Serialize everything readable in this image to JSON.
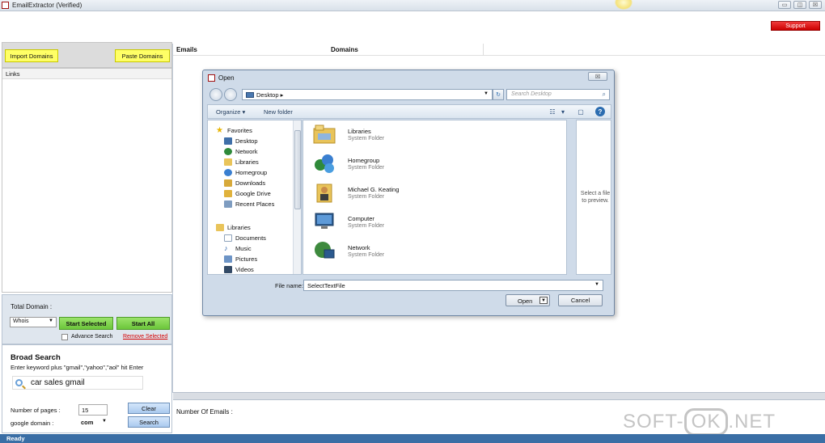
{
  "window": {
    "title": "EmailExtractor  (Verified)",
    "min_glyph": "▭",
    "max_glyph": "◫",
    "close_glyph": "☒"
  },
  "support_label": "Support",
  "left": {
    "import_label": "Import Domains",
    "paste_label": "Paste Domains",
    "links_header": "Links"
  },
  "domain_panel": {
    "total_label": "Total Domain :",
    "whois_value": "Whois",
    "start_selected_label": "Start Selected",
    "start_all_label": "Start All",
    "advance_search_label": "Advance Search",
    "remove_selected_label": "Remove Selected"
  },
  "broad": {
    "title": "Broad Search",
    "description": "Enter keyword plus \"gmail\",\"yahoo\",\"aol\" hit Enter",
    "keyword": "car sales gmail",
    "pages_label": "Number of pages :",
    "pages_value": "15",
    "domain_label": "google domain   :",
    "domain_value": "com",
    "clear_label": "Clear",
    "search_label": "Search"
  },
  "main": {
    "col_emails": "Emails",
    "col_domains": "Domains",
    "num_emails_label": "Number Of Emails :"
  },
  "status": "Ready",
  "watermark": {
    "left": "SOFT-",
    "ok": "OK",
    "right": ".NET"
  },
  "dialog": {
    "title": "Open",
    "close_glyph": "☒",
    "address": "Desktop",
    "search_placeholder": "Search Desktop",
    "organize_label": "Organize ▾",
    "new_folder_label": "New folder",
    "nav_items": [
      {
        "label": "Favorites",
        "icon": "star-icon"
      },
      {
        "label": "Desktop",
        "icon": "desktop-icon"
      },
      {
        "label": "Network",
        "icon": "network-icon"
      },
      {
        "label": "Libraries",
        "icon": "libraries-icon"
      },
      {
        "label": "Homegroup",
        "icon": "homegroup-icon"
      },
      {
        "label": "Downloads",
        "icon": "downloads-icon"
      },
      {
        "label": "Google Drive",
        "icon": "google-drive-icon"
      },
      {
        "label": "Recent Places",
        "icon": "recent-places-icon"
      },
      {
        "label": "Libraries",
        "icon": "libraries-icon"
      },
      {
        "label": "Documents",
        "icon": "documents-icon"
      },
      {
        "label": "Music",
        "icon": "music-icon"
      },
      {
        "label": "Pictures",
        "icon": "pictures-icon"
      },
      {
        "label": "Videos",
        "icon": "videos-icon"
      }
    ],
    "files": [
      {
        "name": "Libraries",
        "type": "System Folder",
        "icon": "libraries-folder-icon"
      },
      {
        "name": "Homegroup",
        "type": "System Folder",
        "icon": "homegroup-icon"
      },
      {
        "name": "Michael G. Keating",
        "type": "System Folder",
        "icon": "user-folder-icon"
      },
      {
        "name": "Computer",
        "type": "System Folder",
        "icon": "computer-icon"
      },
      {
        "name": "Network",
        "type": "System Folder",
        "icon": "network-globe-icon"
      }
    ],
    "preview_text": "Select a file to preview.",
    "filename_label": "File name:",
    "filename_value": "SelectTextFile",
    "open_label": "Open",
    "cancel_label": "Cancel"
  },
  "colors": {
    "accent_yellow": "#ffff66",
    "accent_green": "#6cc63a",
    "support_red": "#dd1111",
    "status_blue": "#3a6ea5"
  }
}
